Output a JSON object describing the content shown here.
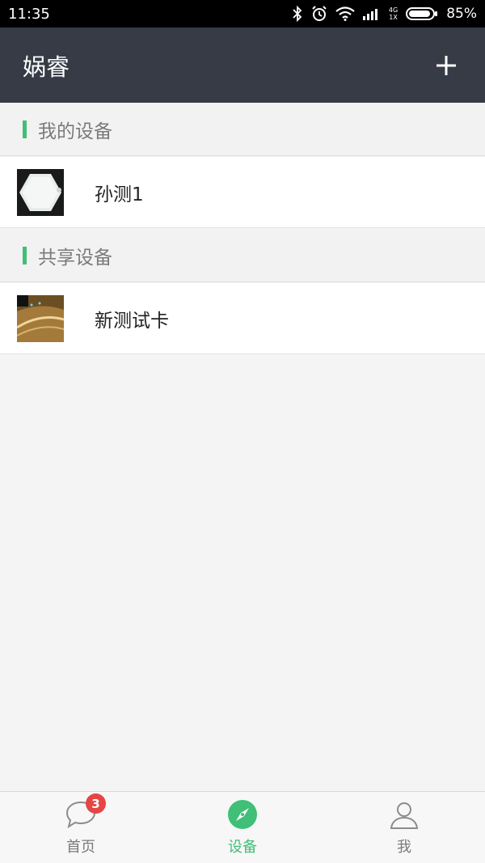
{
  "status_bar": {
    "time": "11:35",
    "battery_percent": "85%",
    "icons": [
      "bluetooth-icon",
      "alarm-icon",
      "wifi-icon",
      "signal-icon",
      "network-4g-icon",
      "battery-icon"
    ],
    "network_label_top": "4G",
    "network_label_bottom": "1X"
  },
  "app_bar": {
    "title": "娲睿",
    "add_icon": "plus-icon"
  },
  "sections": {
    "my_devices": {
      "title": "我的设备",
      "items": [
        {
          "name": "孙测1",
          "thumb": "white-hexagon-device"
        }
      ]
    },
    "shared_devices": {
      "title": "共享设备",
      "items": [
        {
          "name": "新测试卡",
          "thumb": "tunnel-photo"
        }
      ]
    }
  },
  "bottom_nav": {
    "items": [
      {
        "label": "首页",
        "icon": "chat-bubble-icon",
        "badge": "3",
        "active": false
      },
      {
        "label": "设备",
        "icon": "compass-icon",
        "active": true
      },
      {
        "label": "我",
        "icon": "person-icon",
        "active": false
      }
    ]
  },
  "colors": {
    "app_bar": "#363b45",
    "accent": "#3fbf77",
    "badge": "#e64545",
    "background": "#f4f4f4"
  }
}
